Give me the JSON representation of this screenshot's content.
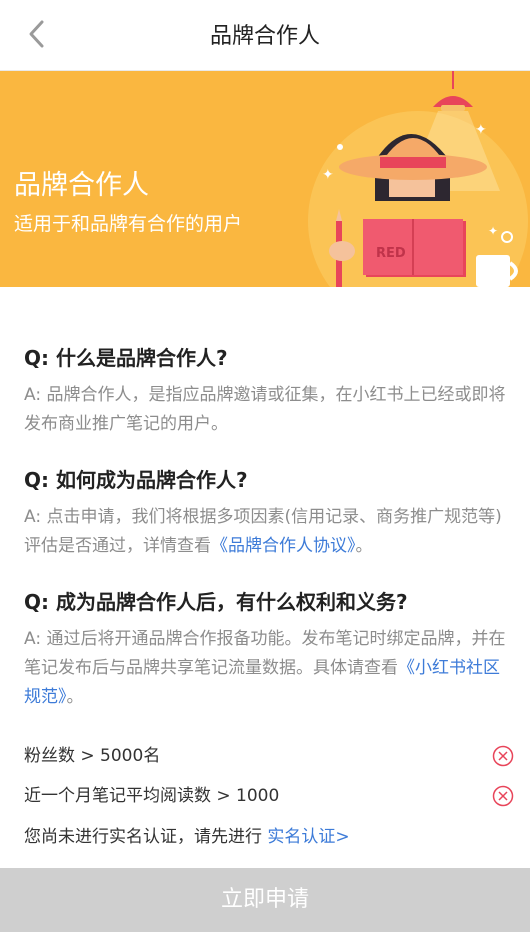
{
  "nav": {
    "title": "品牌合作人"
  },
  "banner": {
    "title": "品牌合作人",
    "subtitle": "适用于和品牌有合作的用户",
    "book_label": "RED"
  },
  "faq": [
    {
      "q": "Q: 什么是品牌合作人?",
      "a": "A: 品牌合作人，是指应品牌邀请或征集，在小红书上已经或即将发布商业推广笔记的用户。"
    },
    {
      "q": "Q: 如何成为品牌合作人?",
      "a": "A: 点击申请，我们将根据多项因素(信用记录、商务推广规范等)评估是否通过，详情查看",
      "link": "《品牌合作人协议》",
      "after": "。"
    },
    {
      "q": "Q: 成为品牌合作人后，有什么权利和义务?",
      "a": "A: 通过后将开通品牌合作报备功能。发布笔记时绑定品牌，并在笔记发布后与品牌共享笔记流量数据。具体请查看",
      "link": "《小红书社区规范》",
      "after": "。"
    }
  ],
  "requirements": [
    {
      "label": "粉丝数 > 5000名",
      "status_icon": "x-circle-icon"
    },
    {
      "label": "近一个月笔记平均阅读数 > 1000",
      "status_icon": "x-circle-icon"
    }
  ],
  "notice": {
    "text": "您尚未进行实名认证，请先进行 ",
    "link": "实名认证>"
  },
  "apply_button": {
    "label": "立即申请"
  },
  "colors": {
    "banner": "#fab740",
    "link": "#3d7bd8",
    "error": "#e8455a",
    "button_disabled": "#cfcfcf"
  }
}
